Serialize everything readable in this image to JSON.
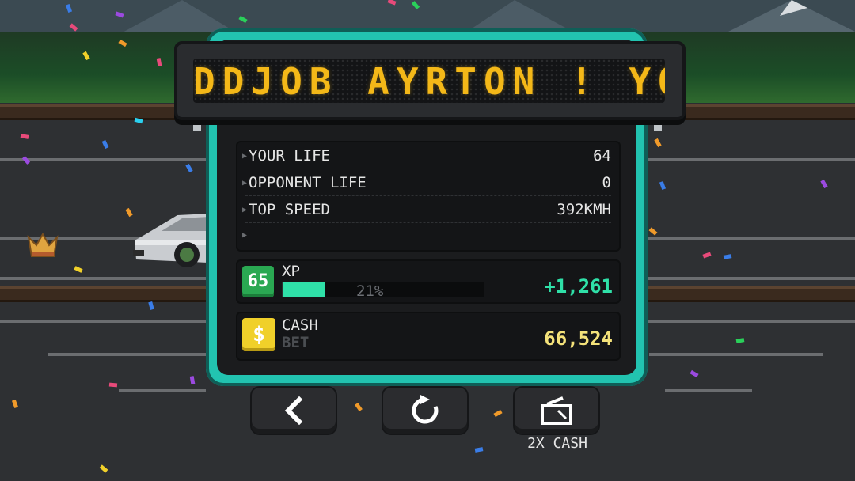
{
  "marquee": {
    "text": "DDJOB AYRTON ! YOU"
  },
  "stats": [
    {
      "label": "YOUR LIFE",
      "value": "64"
    },
    {
      "label": "OPPONENT LIFE",
      "value": "0"
    },
    {
      "label": "TOP SPEED",
      "value": "392KMH"
    },
    {
      "label": "",
      "value": ""
    }
  ],
  "xp": {
    "level": "65",
    "label": "XP",
    "percent_text": "21%",
    "progress": 0.21,
    "gain": "+1,261"
  },
  "cash": {
    "icon_symbol": "$",
    "label": "CASH",
    "sub_label": "BET",
    "value": "66,524"
  },
  "buttons": {
    "back_icon": "back-arrow-icon",
    "restart_icon": "restart-icon",
    "double_cash_icon": "video-ad-icon",
    "double_cash_label": "2X CASH"
  },
  "colors": {
    "panel": "#22c3b0",
    "marquee_text": "#f4b818",
    "xp_accent": "#2fe0a8",
    "cash_value": "#f4e27a",
    "level_badge": "#2aa852",
    "cash_badge": "#f0d02a"
  }
}
